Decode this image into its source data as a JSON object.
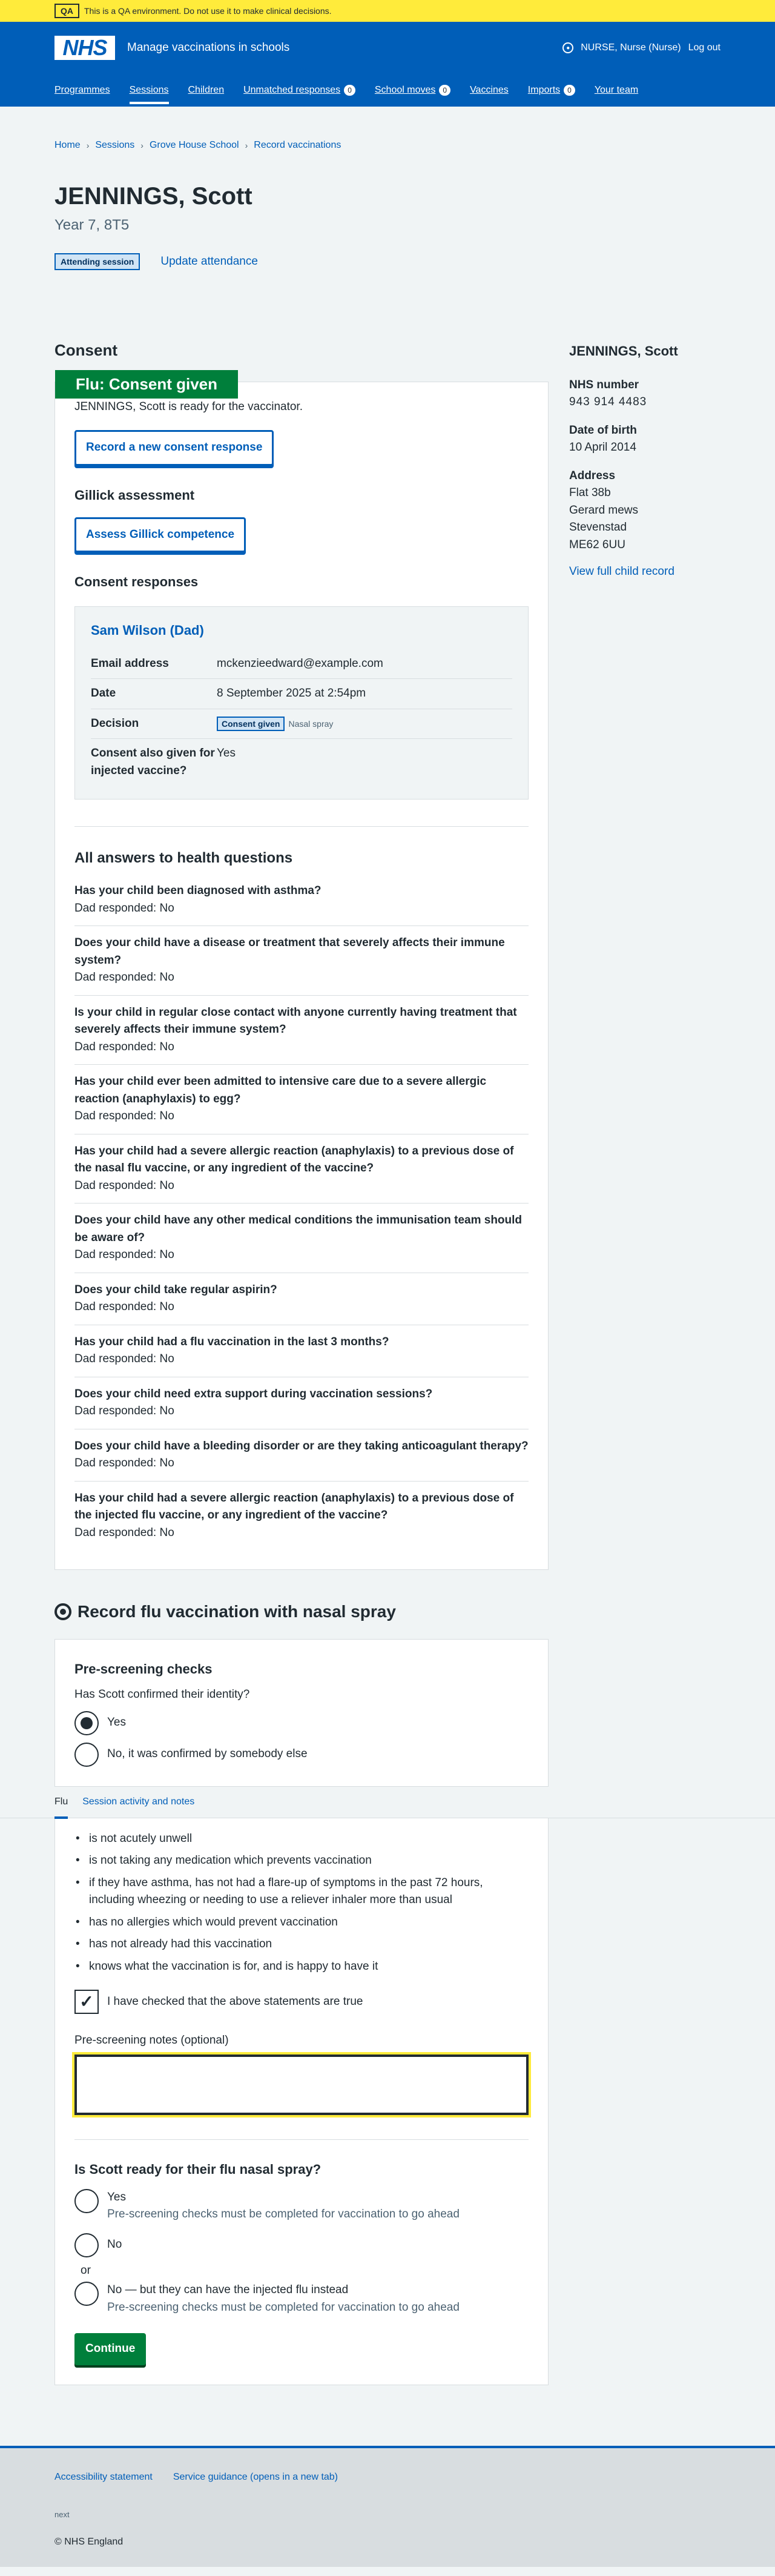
{
  "qa_banner": {
    "tag": "QA",
    "text": "This is a QA environment. Do not use it to make clinical decisions."
  },
  "header": {
    "logo": "NHS",
    "service": "Manage vaccinations in schools",
    "account": "NURSE, Nurse (Nurse)",
    "logout": "Log out",
    "nav": [
      {
        "label": "Programmes",
        "badge": ""
      },
      {
        "label": "Sessions",
        "badge": ""
      },
      {
        "label": "Children",
        "badge": ""
      },
      {
        "label": "Unmatched responses",
        "badge": "0"
      },
      {
        "label": "School moves",
        "badge": "0"
      },
      {
        "label": "Vaccines",
        "badge": ""
      },
      {
        "label": "Imports",
        "badge": "0"
      },
      {
        "label": "Your team",
        "badge": ""
      }
    ]
  },
  "breadcrumb": [
    "Home",
    "Sessions",
    "Grove House School",
    "Record vaccinations"
  ],
  "child": {
    "name": "JENNINGS, Scott",
    "year": "Year 7, 8T5",
    "attending_tag": "Attending session",
    "update_attendance": "Update attendance"
  },
  "consent": {
    "title": "Consent",
    "status": "Flu: Consent given",
    "ready_text": "JENNINGS, Scott is ready for the vaccinator.",
    "record_button": "Record a new consent response",
    "gillick_title": "Gillick assessment",
    "gillick_button": "Assess Gillick competence",
    "responses_title": "Consent responses",
    "response": {
      "name": "Sam Wilson (Dad)",
      "email_key": "Email address",
      "email": "mckenzieedward@example.com",
      "date_key": "Date",
      "date": "8 September 2025 at 2:54pm",
      "decision_key": "Decision",
      "decision_tag": "Consent given",
      "decision_note": "Nasal spray",
      "injected_key": "Consent also given for injected vaccine?",
      "injected": "Yes"
    }
  },
  "health": {
    "title": "All answers to health questions",
    "items": [
      {
        "q": "Has your child been diagnosed with asthma?",
        "a": "Dad responded: No"
      },
      {
        "q": "Does your child have a disease or treatment that severely affects their immune system?",
        "a": "Dad responded: No"
      },
      {
        "q": "Is your child in regular close contact with anyone currently having treatment that severely affects their immune system?",
        "a": "Dad responded: No"
      },
      {
        "q": "Has your child ever been admitted to intensive care due to a severe allergic reaction (anaphylaxis) to egg?",
        "a": "Dad responded: No"
      },
      {
        "q": "Has your child had a severe allergic reaction (anaphylaxis) to a previous dose of the nasal flu vaccine, or any ingredient of the vaccine?",
        "a": "Dad responded: No"
      },
      {
        "q": "Does your child have any other medical conditions the immunisation team should be aware of?",
        "a": "Dad responded: No"
      },
      {
        "q": "Does your child take regular aspirin?",
        "a": "Dad responded: No"
      },
      {
        "q": "Has your child had a flu vaccination in the last 3 months?",
        "a": "Dad responded: No"
      },
      {
        "q": "Does your child need extra support during vaccination sessions?",
        "a": "Dad responded: No"
      },
      {
        "q": "Does your child have a bleeding disorder or are they taking anticoagulant therapy?",
        "a": "Dad responded: No"
      },
      {
        "q": "Has your child had a severe allergic reaction (anaphylaxis) to a previous dose of the injected flu vaccine, or any ingredient of the vaccine?",
        "a": "Dad responded: No"
      }
    ]
  },
  "record": {
    "title": "Record flu vaccination with nasal spray",
    "prescreen_title": "Pre-screening checks",
    "identity_q": "Has Scott confirmed their identity?",
    "identity_yes": "Yes",
    "identity_no": "No, it was confirmed by somebody else",
    "tabs": [
      "Flu",
      "Session activity and notes"
    ],
    "checks": [
      "is not acutely unwell",
      "is not taking any medication which prevents vaccination",
      "if they have asthma, has not had a flare-up of symptoms in the past 72 hours, including wheezing or needing to use a reliever inhaler more than usual",
      "has no allergies which would prevent vaccination",
      "has not already had this vaccination",
      "knows what the vaccination is for, and is happy to have it"
    ],
    "checked_label": "I have checked that the above statements are true",
    "notes_label": "Pre-screening notes (optional)",
    "ready_q": "Is Scott ready for their flu nasal spray?",
    "ready_yes": "Yes",
    "ready_yes_hint": "Pre-screening checks must be completed for vaccination to go ahead",
    "ready_no": "No",
    "ready_or": "or",
    "ready_injected": "No — but they can have the injected flu instead",
    "ready_injected_hint": "Pre-screening checks must be completed for vaccination to go ahead",
    "continue": "Continue"
  },
  "sidebar": {
    "name": "JENNINGS, Scott",
    "nhs_key": "NHS number",
    "nhs": "943  914  4483",
    "dob_key": "Date of birth",
    "dob": "10 April 2014",
    "address_key": "Address",
    "address": [
      "Flat 38b",
      "Gerard mews",
      "Stevenstad",
      "ME62 6UU"
    ],
    "link": "View full child record"
  },
  "footer": {
    "links": [
      "Accessibility statement",
      "Service guidance (opens in a new tab)"
    ],
    "meta": "next",
    "copy": "© NHS England"
  },
  "colors": {
    "nhs_blue": "#005eb8",
    "green": "#007f3b",
    "yellow": "#ffeb3b"
  }
}
